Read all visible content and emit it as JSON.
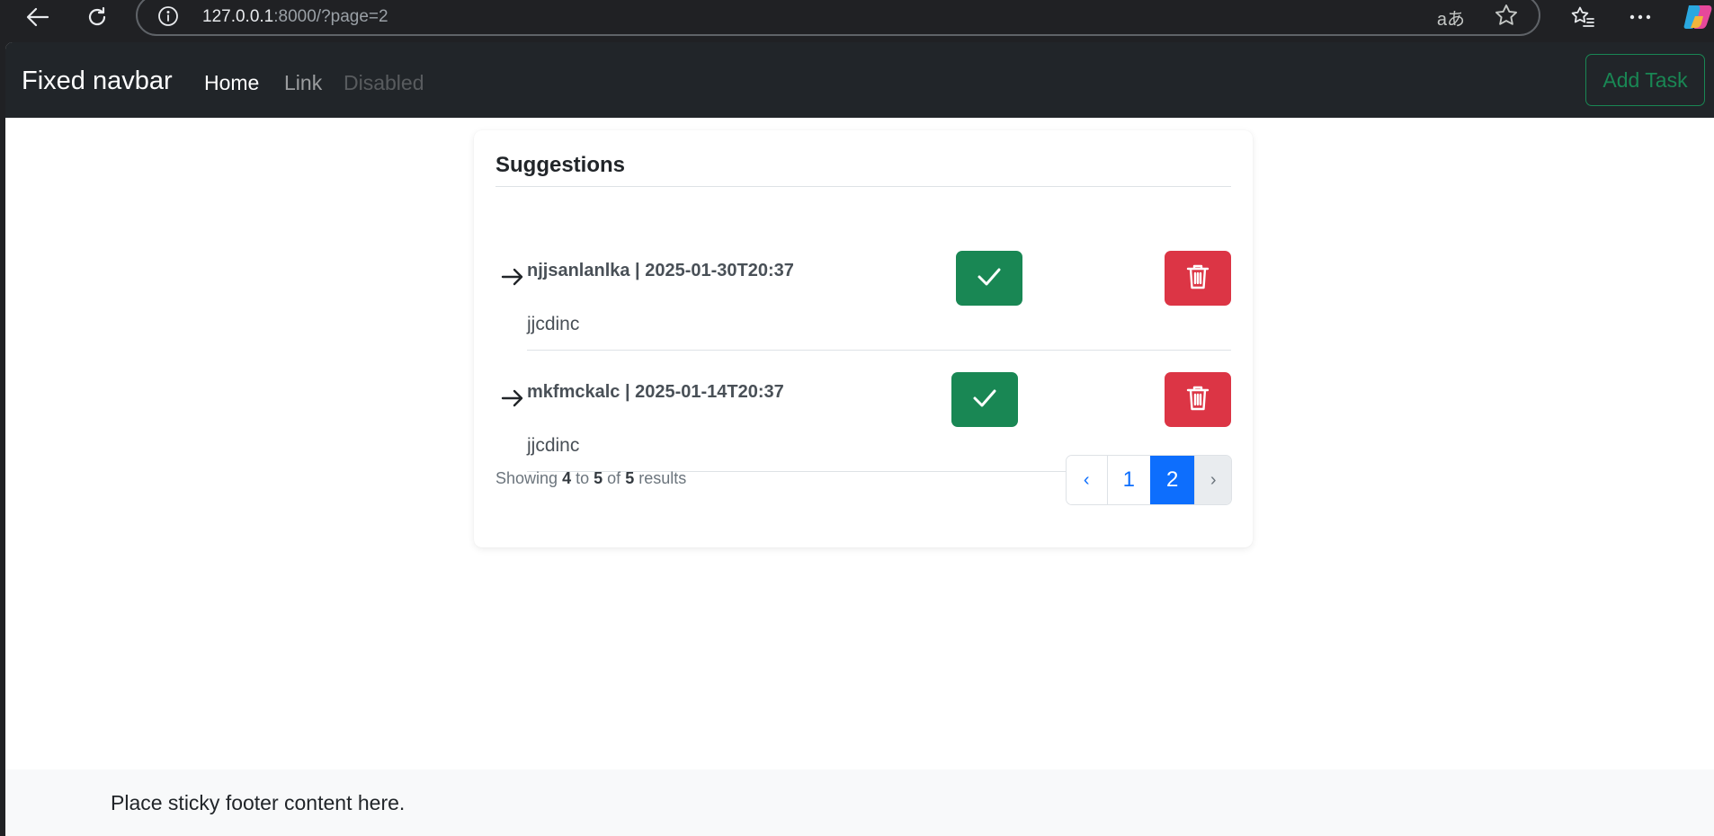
{
  "browser": {
    "url_host": "127.0.0.1",
    "url_rest": ":8000/?page=2",
    "read_aloud_glyph": "aあ"
  },
  "navbar": {
    "brand": "Fixed navbar",
    "links": [
      {
        "label": "Home",
        "state": "active"
      },
      {
        "label": "Link",
        "state": "normal"
      },
      {
        "label": "Disabled",
        "state": "disabled"
      }
    ],
    "add_task_label": "Add Task"
  },
  "card": {
    "title": "Suggestions",
    "items": [
      {
        "heading": "njjsanlanlka | 2025-01-30T20:37",
        "description": "jjcdinc"
      },
      {
        "heading": "mkfmckalc | 2025-01-14T20:37",
        "description": "jjcdinc"
      }
    ],
    "results": {
      "prefix": "Showing",
      "from": "4",
      "to_word": "to",
      "to": "5",
      "of_word": "of",
      "total": "5",
      "suffix": "results"
    },
    "pagination": {
      "prev": "‹",
      "pages": [
        "1",
        "2"
      ],
      "current_page": "2",
      "next": "›"
    }
  },
  "footer": {
    "text": "Place sticky footer content here."
  },
  "colors": {
    "navbar_bg": "#212529",
    "success": "#198754",
    "danger": "#dc3545",
    "primary": "#0d6efd",
    "footer_bg": "#f8f9fa"
  },
  "icons": {
    "back": "arrow-left",
    "reload": "refresh",
    "info": "info-circle",
    "star": "star-outline",
    "favorites": "star-list",
    "more": "ellipsis",
    "item_arrow": "arrow-right",
    "accept": "check",
    "delete": "trash"
  }
}
